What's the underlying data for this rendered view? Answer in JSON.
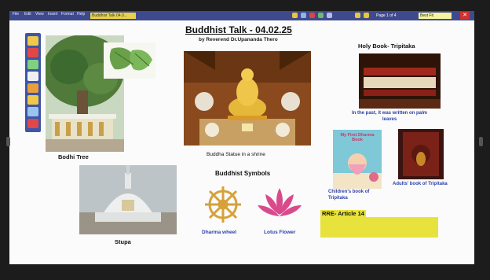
{
  "menu": {
    "items": [
      "File",
      "Edit",
      "View",
      "Insert",
      "Format",
      "Help"
    ]
  },
  "doc_tab": "Buddhist Talk 04.0...",
  "page_indicator": "Page 1 of 4",
  "zoom_level": "Best Fit",
  "header": {
    "title": "Buddhist Talk - 04.02.25",
    "subtitle": "by Reverend Dr.Upananda Thero"
  },
  "labels": {
    "bodhi_tree": "Bodhi Tree",
    "stupa": "Stupa",
    "buddha_statue": "Buddha Statue in a shrine",
    "symbols_heading": "Buddhist Symbols",
    "dharma_wheel": "Dharma wheel",
    "lotus_flower": "Lotus Flower",
    "holy_book": "Holy Book- Tripitaka",
    "palm_leaves": "In the past, it was written on palm leaves",
    "childrens_book": "Children's book of Tripitaka",
    "adults_book": "Adults' book of Tripitaka",
    "childrens_cover_text": "My First Dharma Book",
    "rre_heading": "RRE- Article 14"
  },
  "colors": {
    "accent_blue": "#2b3fa8",
    "menubar": "#3f4a8e",
    "highlight": "#e8e23c",
    "lotus": "#d94a8c",
    "wheel": "#d6a13a"
  }
}
